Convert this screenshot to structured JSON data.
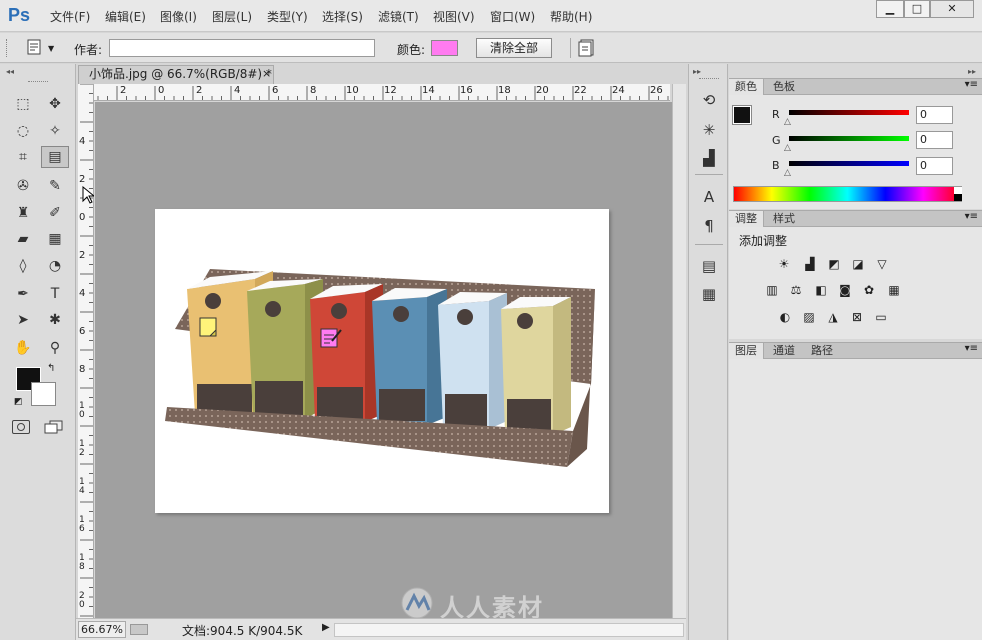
{
  "app": {
    "logo": "Ps"
  },
  "menu": [
    "文件(F)",
    "编辑(E)",
    "图像(I)",
    "图层(L)",
    "类型(Y)",
    "选择(S)",
    "滤镜(T)",
    "视图(V)",
    "窗口(W)",
    "帮助(H)"
  ],
  "window_controls": {
    "minimize": "▁",
    "maximize": "□",
    "close": "✕"
  },
  "options_bar": {
    "author_label": "作者:",
    "author_value": "",
    "color_label": "颜色:",
    "note_color": "#ff7bf0",
    "clear_all_label": "清除全部"
  },
  "tools": [
    {
      "name": "marquee",
      "glyph": "⬚"
    },
    {
      "name": "move",
      "glyph": "✥"
    },
    {
      "name": "lasso",
      "glyph": "◌"
    },
    {
      "name": "magic-wand",
      "glyph": "✧"
    },
    {
      "name": "crop",
      "glyph": "⌗"
    },
    {
      "name": "note",
      "glyph": "▤"
    },
    {
      "name": "spot-healing",
      "glyph": "✇"
    },
    {
      "name": "brush",
      "glyph": "✎"
    },
    {
      "name": "clone-stamp",
      "glyph": "♜"
    },
    {
      "name": "history-brush",
      "glyph": "✐"
    },
    {
      "name": "eraser",
      "glyph": "▰"
    },
    {
      "name": "gradient",
      "glyph": "▦"
    },
    {
      "name": "blur",
      "glyph": "◊"
    },
    {
      "name": "dodge",
      "glyph": "◔"
    },
    {
      "name": "pen",
      "glyph": "✒"
    },
    {
      "name": "type",
      "glyph": "T"
    },
    {
      "name": "path-selection",
      "glyph": "➤"
    },
    {
      "name": "custom-shape",
      "glyph": "✱"
    },
    {
      "name": "hand",
      "glyph": "✋"
    },
    {
      "name": "zoom",
      "glyph": "⚲"
    }
  ],
  "document": {
    "tab_title": "小饰品.jpg @ 66.7%(RGB/8#) *",
    "close_glyph": "×"
  },
  "rulers": {
    "top": [
      "2",
      "0",
      "2",
      "4",
      "6",
      "8",
      "10",
      "12",
      "14",
      "16",
      "18",
      "20",
      "22",
      "24",
      "26"
    ],
    "left": [
      "4",
      "2",
      "0",
      "2",
      "4",
      "6",
      "8",
      "1 0",
      "1 2",
      "1 4",
      "1 6",
      "1 8",
      "2 0"
    ]
  },
  "status": {
    "zoom": "66.67%",
    "doc_size": "文档:904.5 K/904.5K"
  },
  "color_panel": {
    "tabs": [
      "颜色",
      "色板"
    ],
    "channels": [
      {
        "label": "R",
        "value": "0"
      },
      {
        "label": "G",
        "value": "0"
      },
      {
        "label": "B",
        "value": "0"
      }
    ]
  },
  "adjust_panel": {
    "tabs": [
      "调整",
      "样式"
    ],
    "title": "添加调整"
  },
  "layers_panel": {
    "tabs": [
      "图层",
      "通道",
      "路径"
    ]
  },
  "watermark": "人人素材",
  "colors": {
    "canvas_bg": "#a0a0a0",
    "note_color": "#ff7bf0"
  }
}
